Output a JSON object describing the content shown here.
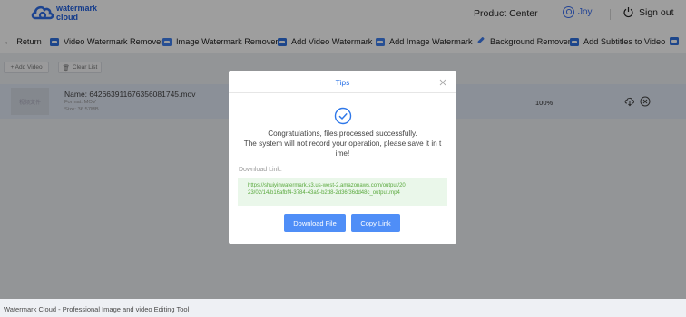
{
  "header": {
    "logo_text_line1": "watermark",
    "logo_text_line2": "cloud",
    "product_center": "Product Center",
    "username": "Joy",
    "sign_out": "Sign out"
  },
  "nav": {
    "return": "Return",
    "items": [
      "Video Watermark Remover",
      "Image Watermark Remover",
      "Add Video Watermark",
      "Add Image Watermark",
      "Background Remover",
      "Add Subtitles to Video"
    ]
  },
  "toolbar": {
    "add_video": "+ Add Video",
    "clear_list": "Clear List"
  },
  "file": {
    "thumb_text": "视频文件",
    "name": "Name:  642663911676356081745.mov",
    "format": "Format:  MOV",
    "size": "Size:  36.57MB",
    "progress": "100%"
  },
  "modal": {
    "title": "Tips",
    "message_line1": "Congratulations, files processed successfully.",
    "message_line2": "The system will not record your operation, please save it in t",
    "message_line3": "ime!",
    "download_label": "Download Link:",
    "link_line1": "https://shuiyinwatermark.s3.us-west-2.amazonaws.com/output/20",
    "link_line2": "23/02/14/b16afbf4-3784-43a9-b2d8-2d36f36dd48c_output.mp4",
    "download_button": "Download File",
    "copy_button": "Copy Link"
  },
  "footer": {
    "text": "Watermark Cloud - Professional Image and video Editing Tool"
  },
  "colors": {
    "brand": "#2060e0",
    "accent": "#4f8ef7",
    "success": "#5aa93e"
  }
}
